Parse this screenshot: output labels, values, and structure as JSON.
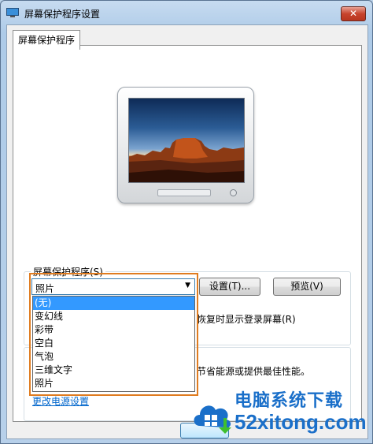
{
  "window": {
    "title": "屏幕保护程序设置",
    "close_label": "✕"
  },
  "tab": {
    "label": "屏幕保护程序"
  },
  "screensaver": {
    "group_label": "屏幕保护程序(S)",
    "selected": "照片",
    "settings_button": "设置(T)...",
    "preview_button": "预览(V)",
    "resume_text_partial": "恢复时显示登录屏幕(R)",
    "options": [
      "(无)",
      "变幻线",
      "彩带",
      "空白",
      "气泡",
      "三维文字",
      "照片"
    ],
    "highlighted_option_index": 0
  },
  "power": {
    "text_partial": "节省能源或提供最佳性能。",
    "link": "更改电源设置"
  },
  "watermark": {
    "title": "电脑系统下载",
    "url": "52xitong.com"
  },
  "colors": {
    "highlight_border": "#e07c20",
    "selection": "#3399ff",
    "link": "#0066cc",
    "watermark": "#1a6fc9"
  }
}
